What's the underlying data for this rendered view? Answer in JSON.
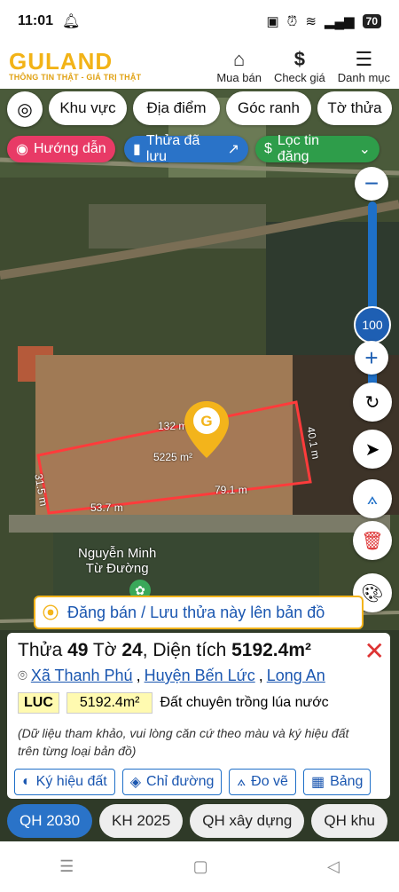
{
  "status": {
    "time": "11:01",
    "battery": "70"
  },
  "header": {
    "logo_main": "GULAND",
    "logo_sub": "THÔNG TIN THẬT - GIÁ TRỊ THẬT",
    "nav": [
      {
        "label": "Mua bán",
        "icon": "home-icon"
      },
      {
        "label": "Check giá",
        "icon": "dollar-icon"
      },
      {
        "label": "Danh mục",
        "icon": "menu-icon"
      }
    ]
  },
  "map_chips": {
    "locate_icon": "target-icon",
    "khu_vuc": "Khu vực",
    "dia_diem": "Địa điểm",
    "goc_ranh": "Góc ranh",
    "to_thua": "Tờ thửa"
  },
  "map_pills": {
    "huong_dan": "Hướng dẫn",
    "thua_da_luu": "Thửa đã lưu",
    "loc_tin_dang": "Lọc tin đăng"
  },
  "zoom": {
    "level": "100"
  },
  "map_labels": {
    "edge_top": "132 m",
    "edge_right": "40.1 m",
    "edge_left": "31.5 m",
    "edge_bottom_left": "53.7 m",
    "edge_bottom_right": "79.1 m",
    "area": "5225 m²",
    "poi_line1": "Nguyễn Minh",
    "poi_line2": "Từ Đường"
  },
  "post_bar": {
    "label": "Đăng bán / Lưu thửa này lên bản đồ"
  },
  "parcel": {
    "thua_prefix": "Thửa ",
    "thua": "49",
    "to_prefix": " Tờ ",
    "to": "24",
    "dt_prefix": ", Diện tích ",
    "area": "5192.4m²",
    "xa": "Xã Thanh Phú",
    "huyen": "Huyện Bến Lức",
    "tinh": "Long An",
    "land_code": "LUC",
    "land_area": "5192.4m²",
    "land_type": "Đất chuyên trồng lúa nước",
    "note": "(Dữ liệu tham khảo, vui lòng căn cứ theo màu và ký hiệu đất trên từng loại bản đồ)"
  },
  "tools": [
    "Ký hiệu đất",
    "Chỉ đường",
    "Đo vẽ",
    "Bảng"
  ],
  "plans": [
    "QH 2030",
    "KH 2025",
    "QH xây dựng",
    "QH khu"
  ],
  "colors": {
    "accent_blue": "#2a73c8",
    "brand_yellow": "#f2b317",
    "parcel_red": "#ff3b3b"
  }
}
